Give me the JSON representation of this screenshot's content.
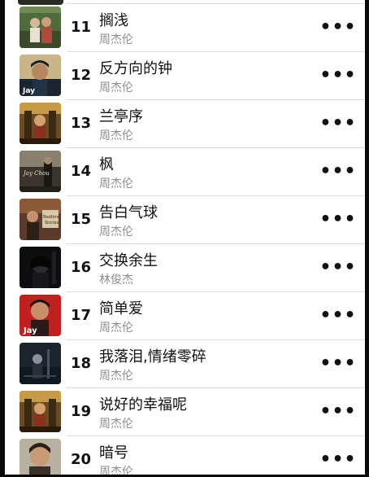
{
  "songs": [
    {
      "number": "11",
      "title": "搁浅",
      "artist": "周杰伦",
      "art": "album-cover-couple"
    },
    {
      "number": "12",
      "title": "反方向的钟",
      "artist": "周杰伦",
      "art": "album-cover-jay"
    },
    {
      "number": "13",
      "title": "兰亭序",
      "artist": "周杰伦",
      "art": "album-cover-golden"
    },
    {
      "number": "14",
      "title": "枫",
      "artist": "周杰伦",
      "art": "album-cover-jay-chou"
    },
    {
      "number": "15",
      "title": "告白气球",
      "artist": "周杰伦",
      "art": "album-cover-bedtime"
    },
    {
      "number": "16",
      "title": "交换余生",
      "artist": "林俊杰",
      "art": "album-cover-dark"
    },
    {
      "number": "17",
      "title": "简单爱",
      "artist": "周杰伦",
      "art": "album-cover-red"
    },
    {
      "number": "18",
      "title": "我落泪,情绪零碎",
      "artist": "周杰伦",
      "art": "album-cover-night"
    },
    {
      "number": "19",
      "title": "说好的幸福呢",
      "artist": "周杰伦",
      "art": "album-cover-golden"
    },
    {
      "number": "20",
      "title": "暗号",
      "artist": "周杰伦",
      "art": "album-cover-portrait"
    }
  ],
  "more_icon": "ellipsis-icon",
  "more_glyph": "•••"
}
